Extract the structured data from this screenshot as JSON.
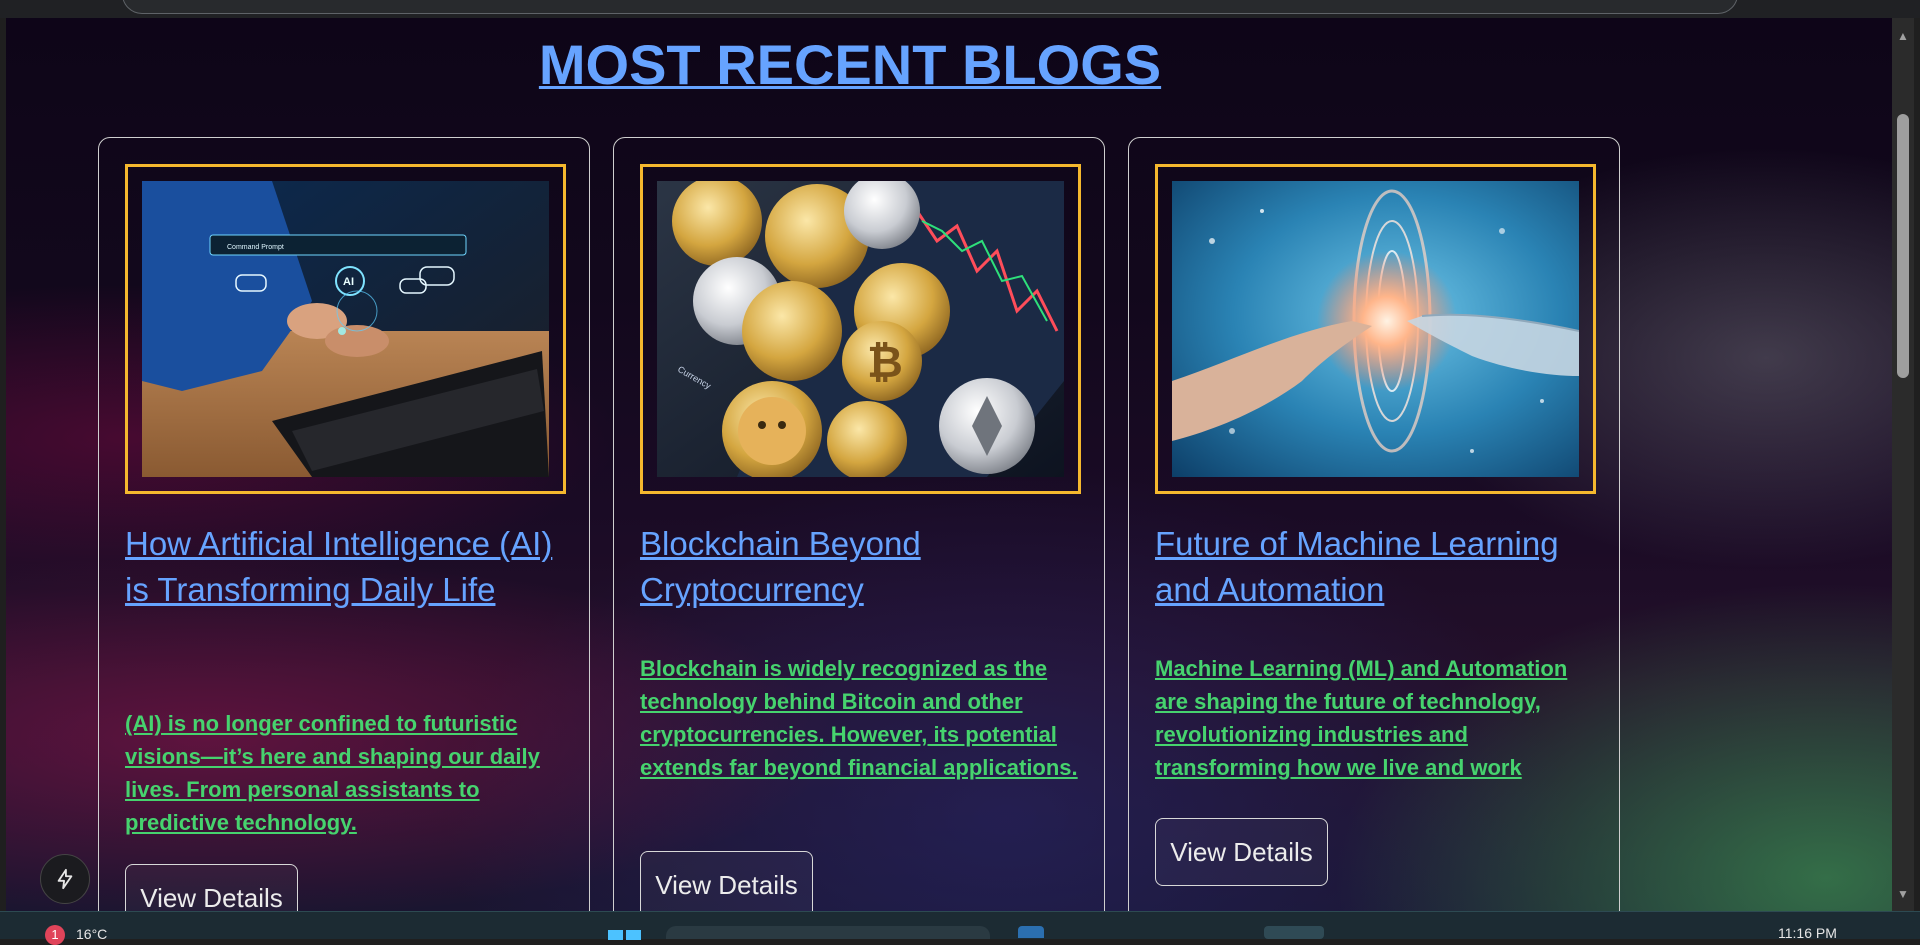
{
  "page": {
    "heading": "MOST RECENT BLOGS"
  },
  "cards": [
    {
      "image_subject": "AI assistant hologram over laptop",
      "title": "How Artificial Intelligence (AI) is Transforming Daily Life",
      "description": "(AI) is no longer confined to futuristic visions—it’s here and shaping our daily lives. From personal assistants to predictive technology.",
      "button_label": "View Details"
    },
    {
      "image_subject": "cryptocurrency coins on trading chart",
      "title": "Blockchain Beyond Cryptocurrency",
      "description": "Blockchain is widely recognized as the technology behind Bitcoin and other cryptocurrencies. However, its potential extends far beyond financial applications.",
      "button_label": "View Details"
    },
    {
      "image_subject": "human and robot hands reaching toward glowing light",
      "title": "Future of Machine Learning and Automation",
      "description": "Machine Learning (ML) and Automation are shaping the future of technology, revolutionizing industries and transforming how we live and work",
      "button_label": "View Details"
    }
  ],
  "image_text": {
    "ai_prompt_bar": "Command Prompt",
    "ai_label": "AI",
    "crypto_label": "Currency"
  },
  "taskbar": {
    "notification_count": "1",
    "temperature": "16°C",
    "time": "11:16 PM"
  },
  "colors": {
    "heading": "#66a3ff",
    "title_link": "#66a3ff",
    "description": "#46d36e",
    "image_frame": "#f5b82e"
  }
}
